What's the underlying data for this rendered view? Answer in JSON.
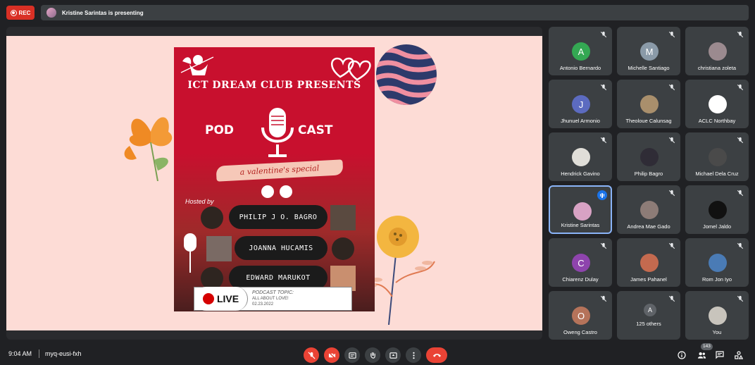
{
  "topbar": {
    "rec_label": "REC",
    "presenting_text": "Kristine Sarintas is presenting"
  },
  "slide": {
    "title": "ICT DREAM CLUB PRESENTS",
    "pod": "POD",
    "cast": "CAST",
    "subtitle": "a valentine's special",
    "hosted_by": "Hosted by",
    "hosts": [
      "PHILIP J O. BAGRO",
      "JOANNA HUCAMIS",
      "EDWARD MARUKOT"
    ],
    "live": "LIVE",
    "topic_label": "PODCAST TOPIC:",
    "topic": "ALL ABOUT LOVE!",
    "date": "02.23.2022"
  },
  "participants": [
    {
      "name": "Antonio Bernardo",
      "initial": "A",
      "color": "#34a853"
    },
    {
      "name": "Michelle Santiago",
      "initial": "M",
      "color": "#8a9aa8"
    },
    {
      "name": "christiana zoleta",
      "initial": "",
      "color": "#9b8a8f"
    },
    {
      "name": "Jhunuel Armonio",
      "initial": "J",
      "color": "#5c6bc0"
    },
    {
      "name": "Theoloue Calunsag",
      "initial": "",
      "color": "#a98f6c"
    },
    {
      "name": "ACLC Northbay",
      "initial": "",
      "color": "#ffffff"
    },
    {
      "name": "Hendrick Gavino",
      "initial": "",
      "color": "#e0ded8"
    },
    {
      "name": "Philip Bagro",
      "initial": "",
      "color": "#2f2c36"
    },
    {
      "name": "Michael Dela Cruz",
      "initial": "",
      "color": "#4a4a4a"
    },
    {
      "name": "Kristine Sarintas",
      "initial": "",
      "color": "#d8a2c4"
    },
    {
      "name": "Andrea Mae Gado",
      "initial": "",
      "color": "#8d7c77"
    },
    {
      "name": "Jomel Jaldo",
      "initial": "",
      "color": "#111111"
    },
    {
      "name": "Chiarenz Dulay",
      "initial": "C",
      "color": "#8e44ad"
    },
    {
      "name": "James Pahanel",
      "initial": "",
      "color": "#c46a4f"
    },
    {
      "name": "Rom Jon Iyo",
      "initial": "",
      "color": "#4a7bb5"
    },
    {
      "name": "Oweng Castro",
      "initial": "O",
      "color": "#b5735a"
    },
    {
      "name": "125 others",
      "initial": "A",
      "color": "#5f6368"
    },
    {
      "name": "You",
      "initial": "",
      "color": "#c8c4bc"
    }
  ],
  "bottombar": {
    "time": "9:04 AM",
    "meeting_code": "myq-eusi-fxh",
    "people_count": "143"
  }
}
